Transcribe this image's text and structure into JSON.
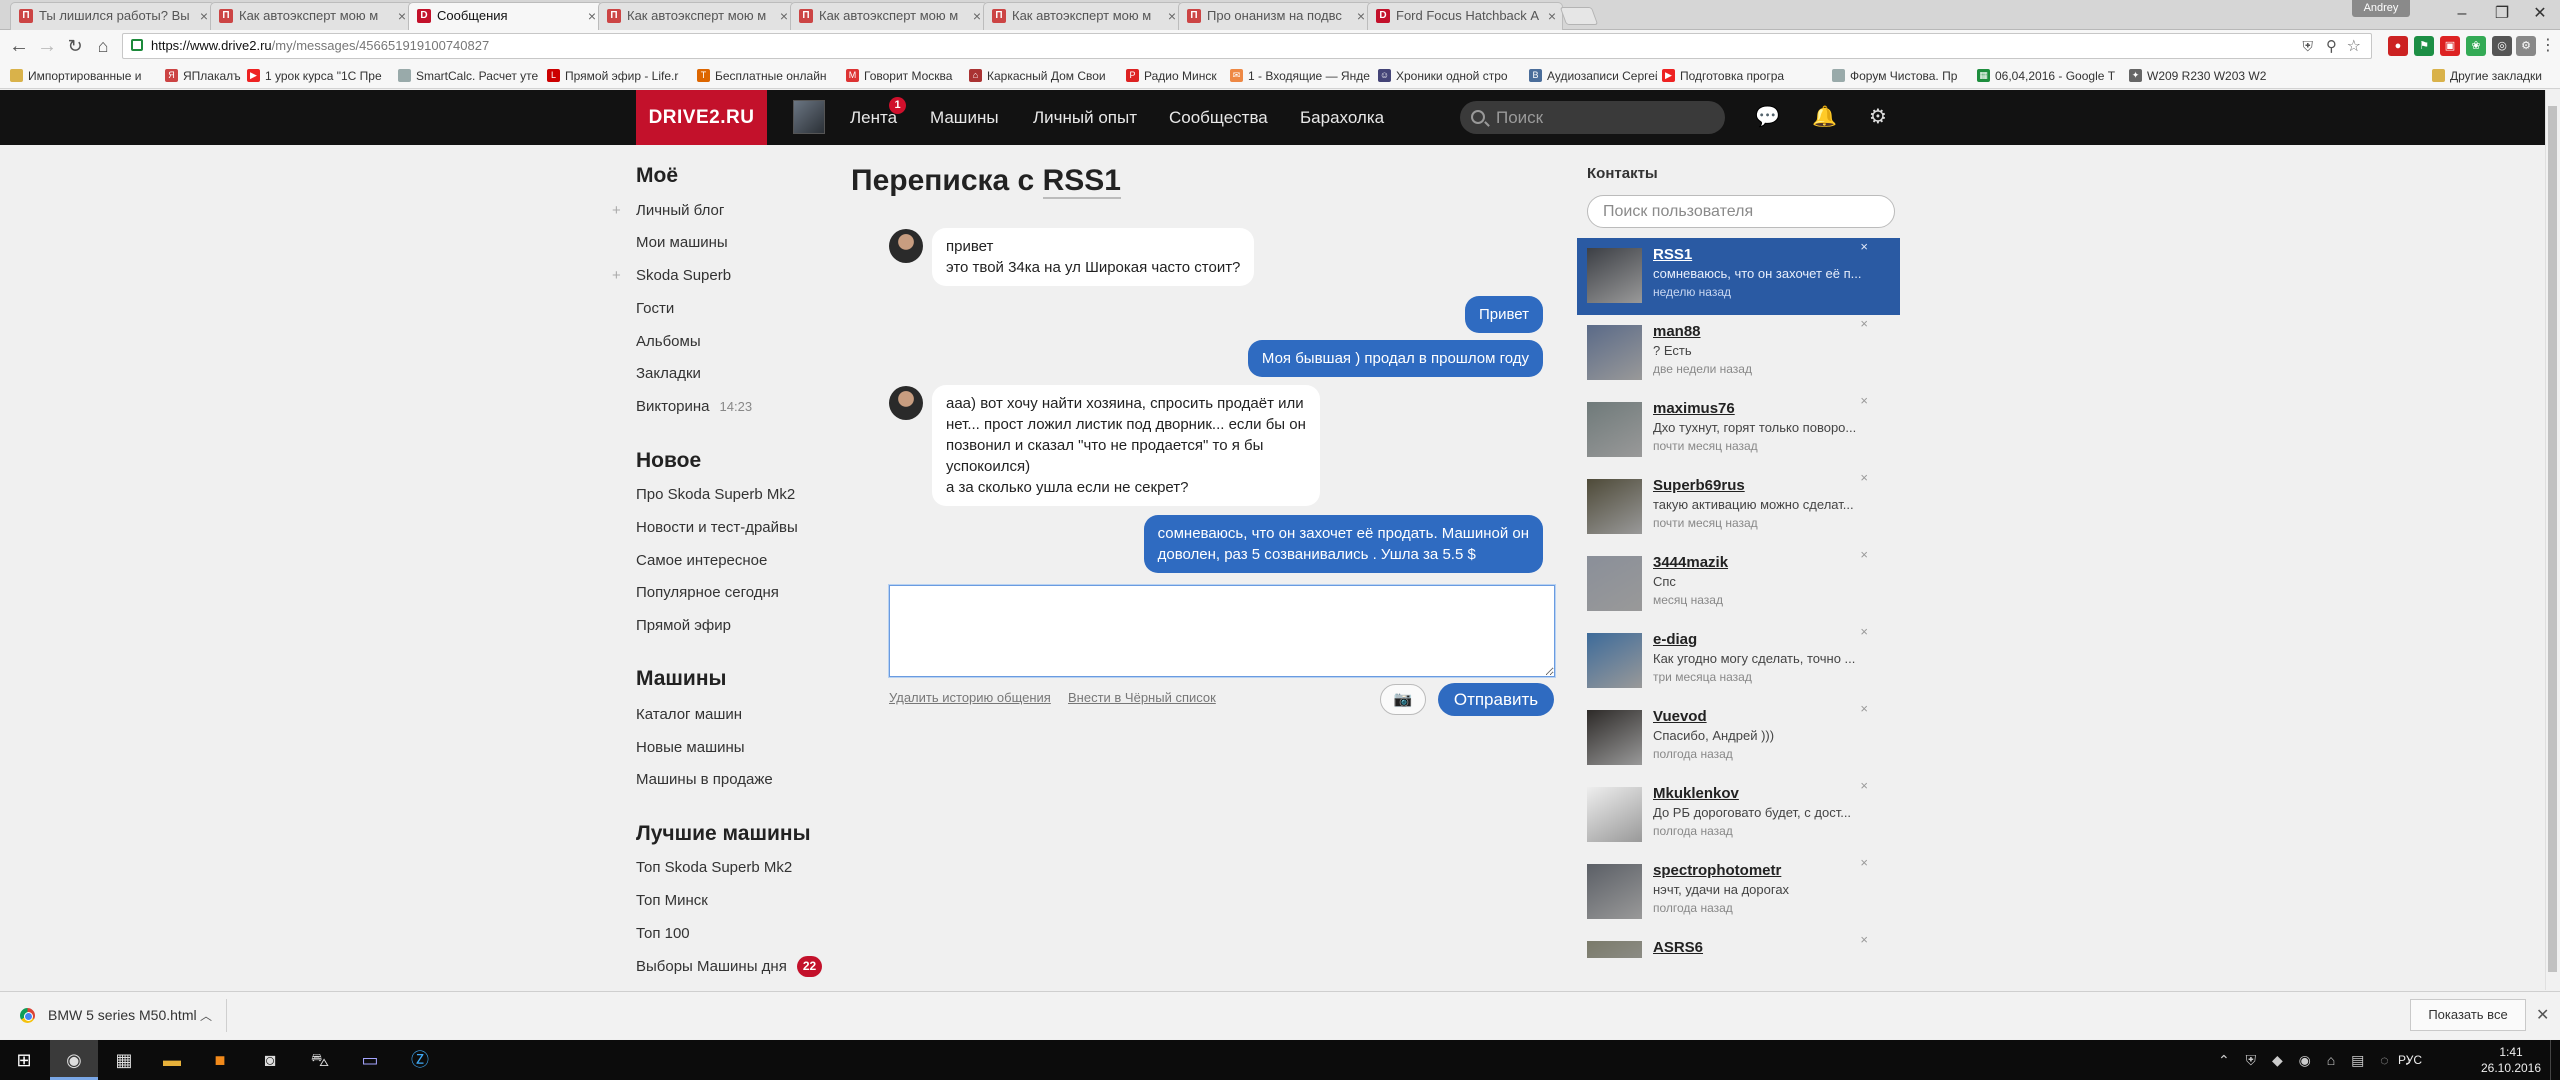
{
  "browser": {
    "tabs": [
      {
        "title": "Ты лишился работы? Вы",
        "favicon": "pikabu-icon",
        "fav_text": "П",
        "fav_color": "#c44"
      },
      {
        "title": "Как автоэксперт мою м",
        "favicon": "pikabu-icon",
        "fav_text": "П",
        "fav_color": "#c44"
      },
      {
        "title": "Сообщения",
        "favicon": "drive2-icon",
        "fav_text": "D",
        "fav_color": "#c3112b"
      },
      {
        "title": "Как автоэксперт мою м",
        "favicon": "pikabu-icon",
        "fav_text": "П",
        "fav_color": "#c44"
      },
      {
        "title": "Как автоэксперт мою м",
        "favicon": "pikabu-icon",
        "fav_text": "П",
        "fav_color": "#c44"
      },
      {
        "title": "Как автоэксперт мою м",
        "favicon": "pikabu-icon",
        "fav_text": "П",
        "fav_color": "#c44"
      },
      {
        "title": "Про онанизм на подвс",
        "favicon": "pikabu-icon",
        "fav_text": "П",
        "fav_color": "#c44"
      },
      {
        "title": "Ford Focus Hatchback А",
        "favicon": "drive2-icon",
        "fav_text": "D",
        "fav_color": "#c3112b"
      }
    ],
    "user_badge": "Andrey",
    "url_host": "https://www.drive2.ru",
    "url_path": "/my/messages/456651919100740827",
    "bookmarks": [
      {
        "label": "Импортированные и",
        "icon": "folder-icon",
        "color": "#d9b24a",
        "glyph": ""
      },
      {
        "label": "ЯПлакалъ",
        "icon": "yaplakal-icon",
        "color": "#c44",
        "glyph": "Я"
      },
      {
        "label": "1 урок курса \"1С Пре",
        "icon": "youtube-icon",
        "color": "#e22",
        "glyph": "▶"
      },
      {
        "label": "SmartCalc. Расчет уте",
        "icon": "page-icon",
        "color": "#9aa",
        "glyph": ""
      },
      {
        "label": "Прямой эфир - Life.r",
        "icon": "life-icon",
        "color": "#c00",
        "glyph": "L"
      },
      {
        "label": "Бесплатные онлайн",
        "icon": "tv-icon",
        "color": "#d60",
        "glyph": "Т"
      },
      {
        "label": "Говорит Москва",
        "icon": "radio-icon",
        "color": "#d33",
        "glyph": "М"
      },
      {
        "label": "Каркасный Дом Свои",
        "icon": "house-icon",
        "color": "#a33",
        "glyph": "⌂"
      },
      {
        "label": "Радио Минск",
        "icon": "radio-minsk-icon",
        "color": "#d22",
        "glyph": "Р"
      },
      {
        "label": "1 - Входящие — Янде",
        "icon": "mail-icon",
        "color": "#e84",
        "glyph": "✉"
      },
      {
        "label": "Хроники одной стро",
        "icon": "person-icon",
        "color": "#447",
        "glyph": "☺"
      },
      {
        "label": "Аудиозаписи Сергей",
        "icon": "vk-icon",
        "color": "#4a6d9a",
        "glyph": "В"
      },
      {
        "label": "Подготовка програ",
        "icon": "youtube-icon",
        "color": "#e22",
        "glyph": "▶"
      },
      {
        "label": "Форум Чистова. Пр",
        "icon": "page-icon",
        "color": "#9aa",
        "glyph": ""
      },
      {
        "label": "06,04,2016 - Google Т",
        "icon": "sheets-icon",
        "color": "#1e8e3e",
        "glyph": "▦"
      },
      {
        "label": "W209 R230 W203 W2",
        "icon": "mercedes-icon",
        "color": "#666",
        "glyph": "✦"
      }
    ],
    "other_bookmarks": "Другие закладки"
  },
  "site": {
    "logo": "DRIVE2.RU",
    "nav": [
      "Лента",
      "Машины",
      "Личный опыт",
      "Сообщества",
      "Барахолка"
    ],
    "feed_badge": "1",
    "search_placeholder": "Поиск"
  },
  "sidebar": {
    "my_title": "Моё",
    "my_items": [
      {
        "label": "Личный блог",
        "plus": true
      },
      {
        "label": "Мои машины",
        "plus": false
      },
      {
        "label": "Skoda Superb",
        "plus": true
      },
      {
        "label": "Гости",
        "plus": false
      },
      {
        "label": "Альбомы",
        "plus": false
      },
      {
        "label": "Закладки",
        "plus": false
      },
      {
        "label": "Викторина",
        "plus": false,
        "time": "14:23"
      }
    ],
    "new_title": "Новое",
    "new_items": [
      "Про Skoda Superb Mk2",
      "Новости и тест-драйвы",
      "Самое интересное",
      "Популярное сегодня",
      "Прямой эфир"
    ],
    "cars_title": "Машины",
    "cars_items": [
      "Каталог машин",
      "Новые машины",
      "Машины в продаже"
    ],
    "best_title": "Лучшие машины",
    "best_items": [
      "Топ Skoda Superb Mk2",
      "Топ Минск",
      "Топ 100",
      "Выборы Машины дня"
    ],
    "best_badge": "22"
  },
  "conversation": {
    "title_prefix": "Переписка с",
    "title_user": "RSS1",
    "messages": [
      {
        "dir": "in",
        "text": "привет\nэто твой 34ка на ул Широкая часто стоит?"
      },
      {
        "dir": "out",
        "text": "Привет"
      },
      {
        "dir": "out",
        "text": "Моя бывшая ) продал в прошлом году"
      },
      {
        "dir": "in",
        "text": "ааа) вот хочу найти хозяина, спросить продаёт или\nнет... прост ложил листик под дворник... если бы он\nпозвонил и сказал \"что не продается\" то я бы\nуспокоился)\nа за сколько ушла если не секрет?"
      },
      {
        "dir": "out",
        "text": "сомневаюсь, что он захочет её продать. Машиной он\nдоволен, раз 5 созванивались . Ушла за 5.5 $"
      }
    ],
    "delete_history": "Удалить историю общения",
    "blacklist": "Внести в Чёрный список",
    "send": "Отправить",
    "reply_value": ""
  },
  "contacts": {
    "title": "Контакты",
    "search_placeholder": "Поиск пользователя",
    "items": [
      {
        "name": "RSS1",
        "msg": "сомневаюсь, что он захочет её п...",
        "time": "неделю назад",
        "selected": true,
        "color": "#3c3f45"
      },
      {
        "name": "man88",
        "msg": "? Есть",
        "time": "две недели назад",
        "selected": false,
        "color": "#5a6a88"
      },
      {
        "name": "maximus76",
        "msg": "Дхо тухнут, горят только поворо...",
        "time": "почти месяц назад",
        "selected": false,
        "color": "#6f7a7a"
      },
      {
        "name": "Superb69rus",
        "msg": "такую активацию можно сделат...",
        "time": "почти месяц назад",
        "selected": false,
        "color": "#4e4a38"
      },
      {
        "name": "3444mazik",
        "msg": "Спс",
        "time": "месяц назад",
        "selected": false,
        "color": "#8a8f99"
      },
      {
        "name": "e-diag",
        "msg": "Как угодно могу сделать, точно ...",
        "time": "три месяца назад",
        "selected": false,
        "color": "#3d6b9a"
      },
      {
        "name": "Vuevod",
        "msg": "Спасибо, Андрей )))",
        "time": "полгода назад",
        "selected": false,
        "color": "#2d2a28"
      },
      {
        "name": "Mkuklenkov",
        "msg": "До РБ дороговато будет, с дост...",
        "time": "полгода назад",
        "selected": false,
        "color": "#eeeeee"
      },
      {
        "name": "spectrophotometr",
        "msg": "нэчт, удачи на дорогах",
        "time": "полгода назад",
        "selected": false,
        "color": "#5b5f66"
      },
      {
        "name": "ASRS6",
        "msg": "",
        "time": "",
        "selected": false,
        "color": "#7a7a6a"
      }
    ]
  },
  "download": {
    "file": "BMW 5 series M50.html",
    "show_all": "Показать все"
  },
  "taskbar": {
    "lang": "РУС",
    "time": "1:41",
    "date": "26.10.2016"
  }
}
